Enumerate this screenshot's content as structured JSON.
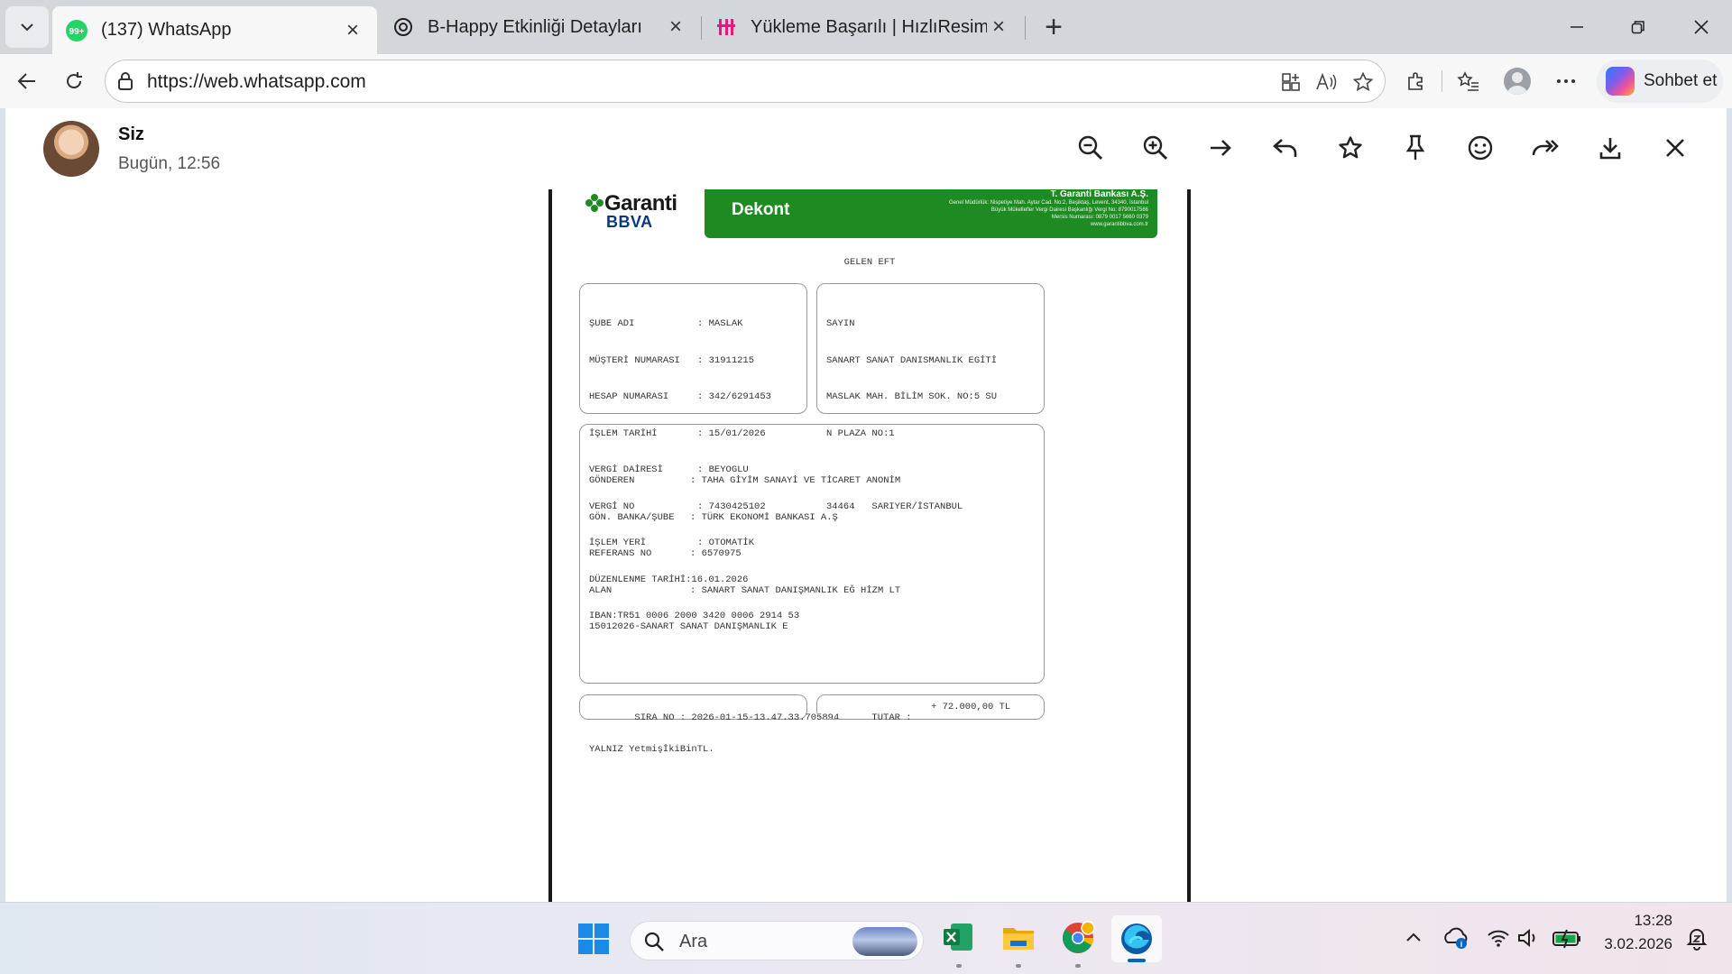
{
  "browser": {
    "tabs": [
      {
        "title": "(137) WhatsApp",
        "badge": "99+",
        "active": true
      },
      {
        "title": "B-Happy Etkinliği Detayları",
        "active": false
      },
      {
        "title": "Yükleme Başarılı | HızlıResim",
        "active": false
      }
    ],
    "address_bar": {
      "url": "https://web.whatsapp.com"
    },
    "copilot_label": "Sohbet et"
  },
  "viewer": {
    "sender_name": "Siz",
    "timestamp": "Bugün, 12:56",
    "tools": [
      "zoom-out-icon",
      "zoom-in-icon",
      "next-icon",
      "reply-icon",
      "star-icon",
      "pin-icon",
      "react-icon",
      "forward-icon",
      "download-icon",
      "close-icon"
    ]
  },
  "document": {
    "bank_logo": {
      "name": "Garanti",
      "sub": "BBVA"
    },
    "banner": {
      "title": "Dekont",
      "bank_name": "T. Garanti Bankası A.Ş.",
      "address_lines": [
        "Genel Müdürlük: Nispetiye Mah. Aytar Cad. No:2, Beşiktaş, Levent, 34340, İstanbul",
        "Büyük Mükellefler Vergi Dairesi Başkanlığı Vergi No: 8790017566",
        "Mersis Numarası: 0879 0017 5660 0379",
        "www.garantibbva.com.tr"
      ]
    },
    "heading": "GELEN EFT",
    "account_info": [
      {
        "key": "ŞUBE ADI",
        "value": "MASLAK"
      },
      {
        "key": "MÜŞTERİ NUMARASI",
        "value": "31911215"
      },
      {
        "key": "HESAP NUMARASI",
        "value": "342/6291453"
      },
      {
        "key": "İŞLEM TARİHİ",
        "value": "15/01/2026"
      },
      {
        "key": "VERGİ DAİRESİ",
        "value": "BEYOGLU"
      },
      {
        "key": "VERGİ NO",
        "value": "7430425102"
      },
      {
        "key": "İŞLEM YERİ",
        "value": "OTOMATİK"
      }
    ],
    "issue_date_line": "DÜZENLENME TARİHİ:16.01.2026",
    "iban_line": "IBAN:TR51 0006 2000 3420 0006 2914 53",
    "recipient_block": [
      "SAYIN",
      "SANART SANAT DANISMANLIK EGİTİ",
      "MASLAK MAH. BİLİM SOK. NO:5 SU",
      "N PLAZA NO:1",
      "",
      "34464   SARIYER/İSTANBUL"
    ],
    "transfer_info": [
      {
        "key": "GÖNDEREN",
        "value": "TAHA GİYİM SANAYİ VE TİCARET ANONİM"
      },
      {
        "key": "GÖN. BANKA/ŞUBE",
        "value": "TÜRK EKONOMİ BANKASI A.Ş"
      },
      {
        "key": "REFERANS NO",
        "value": "6570975"
      },
      {
        "key": "ALAN",
        "value": "SANART SANAT DANIŞMANLIK EĞ HİZM LT"
      }
    ],
    "description_line": "15012026-SANART SANAT DANIŞMANLIK E",
    "amount_words": "YALNIZ YetmişİkiBinTL.",
    "sequence_line": "SIRA NO : 2026-01-15-13.47.33.705894",
    "amount_label": "TUTAR :",
    "amount_value": "+ 72.000,00 TL"
  },
  "taskbar": {
    "search_placeholder": "Ara",
    "time": "13:28",
    "date": "3.02.2026"
  },
  "colors": {
    "banner_green": "#1d8b22",
    "whatsapp_green": "#25d366",
    "edge_blue": "#0c59a4"
  }
}
